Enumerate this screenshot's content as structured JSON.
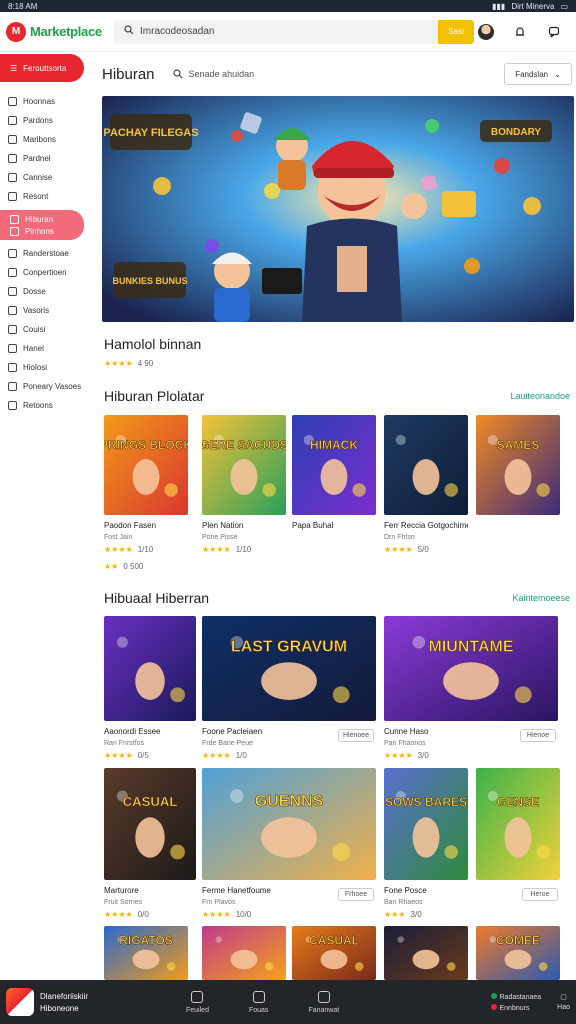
{
  "status_bar": {
    "left": "8:18 AM",
    "right": "Dirt Minerva"
  },
  "topbar": {
    "app_name": "Marketplace",
    "search_placeholder": "Imracodeosadan",
    "search_button": "Sasi"
  },
  "sidebar": {
    "primary": "Ferouttsorta",
    "items": [
      {
        "label": "Hoonnas",
        "icon": "home-icon"
      },
      {
        "label": "Pardons",
        "icon": "list-icon"
      },
      {
        "label": "Maribons",
        "icon": "bag-icon"
      },
      {
        "label": "Pardnel",
        "icon": "user-icon"
      },
      {
        "label": "Cannise",
        "icon": "grid-icon"
      },
      {
        "label": "Resont",
        "icon": "clock-icon"
      }
    ],
    "active": {
      "label": "Hiburan",
      "sub": "Pinhons"
    },
    "items2": [
      {
        "label": "Randerstoae",
        "icon": "tag-icon"
      },
      {
        "label": "Conpertioen",
        "icon": "chart-icon"
      },
      {
        "label": "Dosse",
        "icon": "box-icon"
      },
      {
        "label": "Vasoris",
        "icon": "star-icon"
      },
      {
        "label": "Couisi",
        "icon": "gift-icon"
      },
      {
        "label": "Hanel",
        "icon": "cart-icon"
      },
      {
        "label": "Hiolosi",
        "icon": "heart-icon"
      },
      {
        "label": "Poneary Vasoes",
        "icon": "globe-icon"
      },
      {
        "label": "Retoons",
        "icon": "gear-icon"
      }
    ]
  },
  "page": {
    "title": "Hiburan",
    "search_text": "Senade ahuidan",
    "sort_label": "Fandslan"
  },
  "hero": {
    "badge_left": "PACHAY FILEGAS",
    "badge_right": "BONDARY",
    "badge_bottom": "BUNKIES BUNUS",
    "title": "Hamolol binnan",
    "stars": "★★★★",
    "rating": "4 90"
  },
  "section1": {
    "title": "Hiburan Plolatar",
    "link": "Lauiteonandoe",
    "cards": [
      {
        "art": "SPRINGS BLOCKS",
        "name": "Paodon Fasen",
        "sub": "Fost Jain",
        "stars": "★★★★",
        "rating": "1/10",
        "c1": "#f29a1a",
        "c2": "#d9372f"
      },
      {
        "art": "GERE SACUDS",
        "name": "Plen Nation",
        "sub": "Pone Pisse",
        "stars": "★★★★",
        "rating": "1/10",
        "c1": "#f5c23a",
        "c2": "#2a9f5a"
      },
      {
        "art": "HIMACK",
        "name": "Papa Buhal",
        "sub": "",
        "stars": "",
        "rating": "",
        "c1": "#2d3fb3",
        "c2": "#7b2ecf"
      },
      {
        "art": "",
        "name": "Ferr Reccia Gotgochimes",
        "sub": "Drn Fhtsn",
        "stars": "★★★★",
        "rating": "5/0",
        "c1": "#1e3a63",
        "c2": "#0e1e36"
      },
      {
        "art": "SAMES",
        "name": "",
        "sub": "",
        "stars": "",
        "rating": "",
        "c1": "#f08a24",
        "c2": "#3b2a7a"
      }
    ],
    "extra_stars": "★★",
    "extra_rating": "0 500"
  },
  "section2": {
    "title": "Hibuaal Hiberran",
    "link": "Kaintemoeese",
    "row1": [
      {
        "art": "",
        "name": "Aaonordi Essee",
        "sub": "Ran Fnrstfos",
        "stars": "★★★★",
        "rating": "0/5",
        "c1": "#6a2fc2",
        "c2": "#1a1a5a",
        "tag": ""
      },
      {
        "art": "LAST GRAVUM",
        "name": "Foone Pacleiaen",
        "sub": "Frde Bane Peue",
        "stars": "★★★★",
        "rating": "1/0",
        "c1": "#0f2f66",
        "c2": "#131b3a",
        "tag": "Hienoee"
      },
      {
        "art": "MIUNTAME",
        "name": "Cunne Haso",
        "sub": "Pan Fhaonos",
        "stars": "★★★★",
        "rating": "3/0",
        "c1": "#8a3ad8",
        "c2": "#2a1560",
        "tag": "Hienoe"
      }
    ],
    "row2": [
      {
        "art": "CASUAL",
        "name": "Marturore",
        "sub": "Fruit Sornes",
        "stars": "★★★★",
        "rating": "0/0",
        "c1": "#5a3a2a",
        "c2": "#1c1a1a",
        "tag": ""
      },
      {
        "art": "GUENNS",
        "name": "Ferme Hanetfoume",
        "sub": "Frn Plavos",
        "stars": "★★★★",
        "rating": "10/0",
        "c1": "#4fa0d8",
        "c2": "#f0b04a",
        "tag": "Frhoee"
      },
      {
        "art": "SOWS BARES",
        "name": "Fone Posce",
        "sub": "Ban Rhaeos",
        "stars": "★★★",
        "rating": "3/0",
        "c1": "#5a6fd0",
        "c2": "#2e8a3a",
        "tag": ""
      },
      {
        "art": "GENSE",
        "name": "",
        "sub": "",
        "stars": "",
        "rating": "",
        "c1": "#3bb24a",
        "c2": "#f2d23a",
        "tag": "Heroe"
      }
    ],
    "row3": [
      {
        "art": "RIGATOS",
        "c1": "#2a6ad0",
        "c2": "#f29a1a"
      },
      {
        "art": "",
        "c1": "#c23a8a",
        "c2": "#f2a21a"
      },
      {
        "art": "CASUAL",
        "c1": "#e87a1a",
        "c2": "#7a2a1a"
      },
      {
        "art": "",
        "c1": "#1a1e3a",
        "c2": "#6a3a1a"
      },
      {
        "art": "COMEE",
        "c1": "#f07a2a",
        "c2": "#2a5ab0"
      }
    ]
  },
  "bottom": {
    "app_line1": "Dlaneforiiskiir",
    "app_line2": "Hiboneone",
    "nav": [
      {
        "label": "Feuiled",
        "icon": "grid-icon"
      },
      {
        "label": "Fouas",
        "icon": "compass-icon"
      },
      {
        "label": "Fananwat",
        "icon": "search-icon"
      }
    ],
    "status1": "Radastanaea",
    "status2": "Ennbnurs",
    "status3": "Hao"
  }
}
